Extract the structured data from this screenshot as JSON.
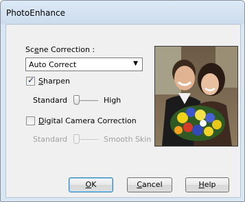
{
  "window": {
    "title": "PhotoEnhance"
  },
  "scene": {
    "label_pre": "Sc",
    "label_key": "e",
    "label_post": "ne Correction :",
    "selected": "Auto Correct"
  },
  "sharpen": {
    "checked": true,
    "label_key": "S",
    "label_rest": "harpen",
    "min_label": "Standard",
    "max_label": "High",
    "level": 0
  },
  "digital": {
    "checked": false,
    "label_key": "D",
    "label_rest": "igital Camera Correction",
    "min_label": "Standard",
    "max_label": "Smooth Skin",
    "level": 0
  },
  "buttons": {
    "ok_key": "O",
    "ok_rest": "K",
    "cancel_key": "C",
    "cancel_rest": "ancel",
    "help_key": "H",
    "help_rest": "elp"
  },
  "colors": {
    "title_bar": "#dce9f6",
    "dialog_bg": "#f0f0f0",
    "default_button_border": "#3c7fb1"
  }
}
